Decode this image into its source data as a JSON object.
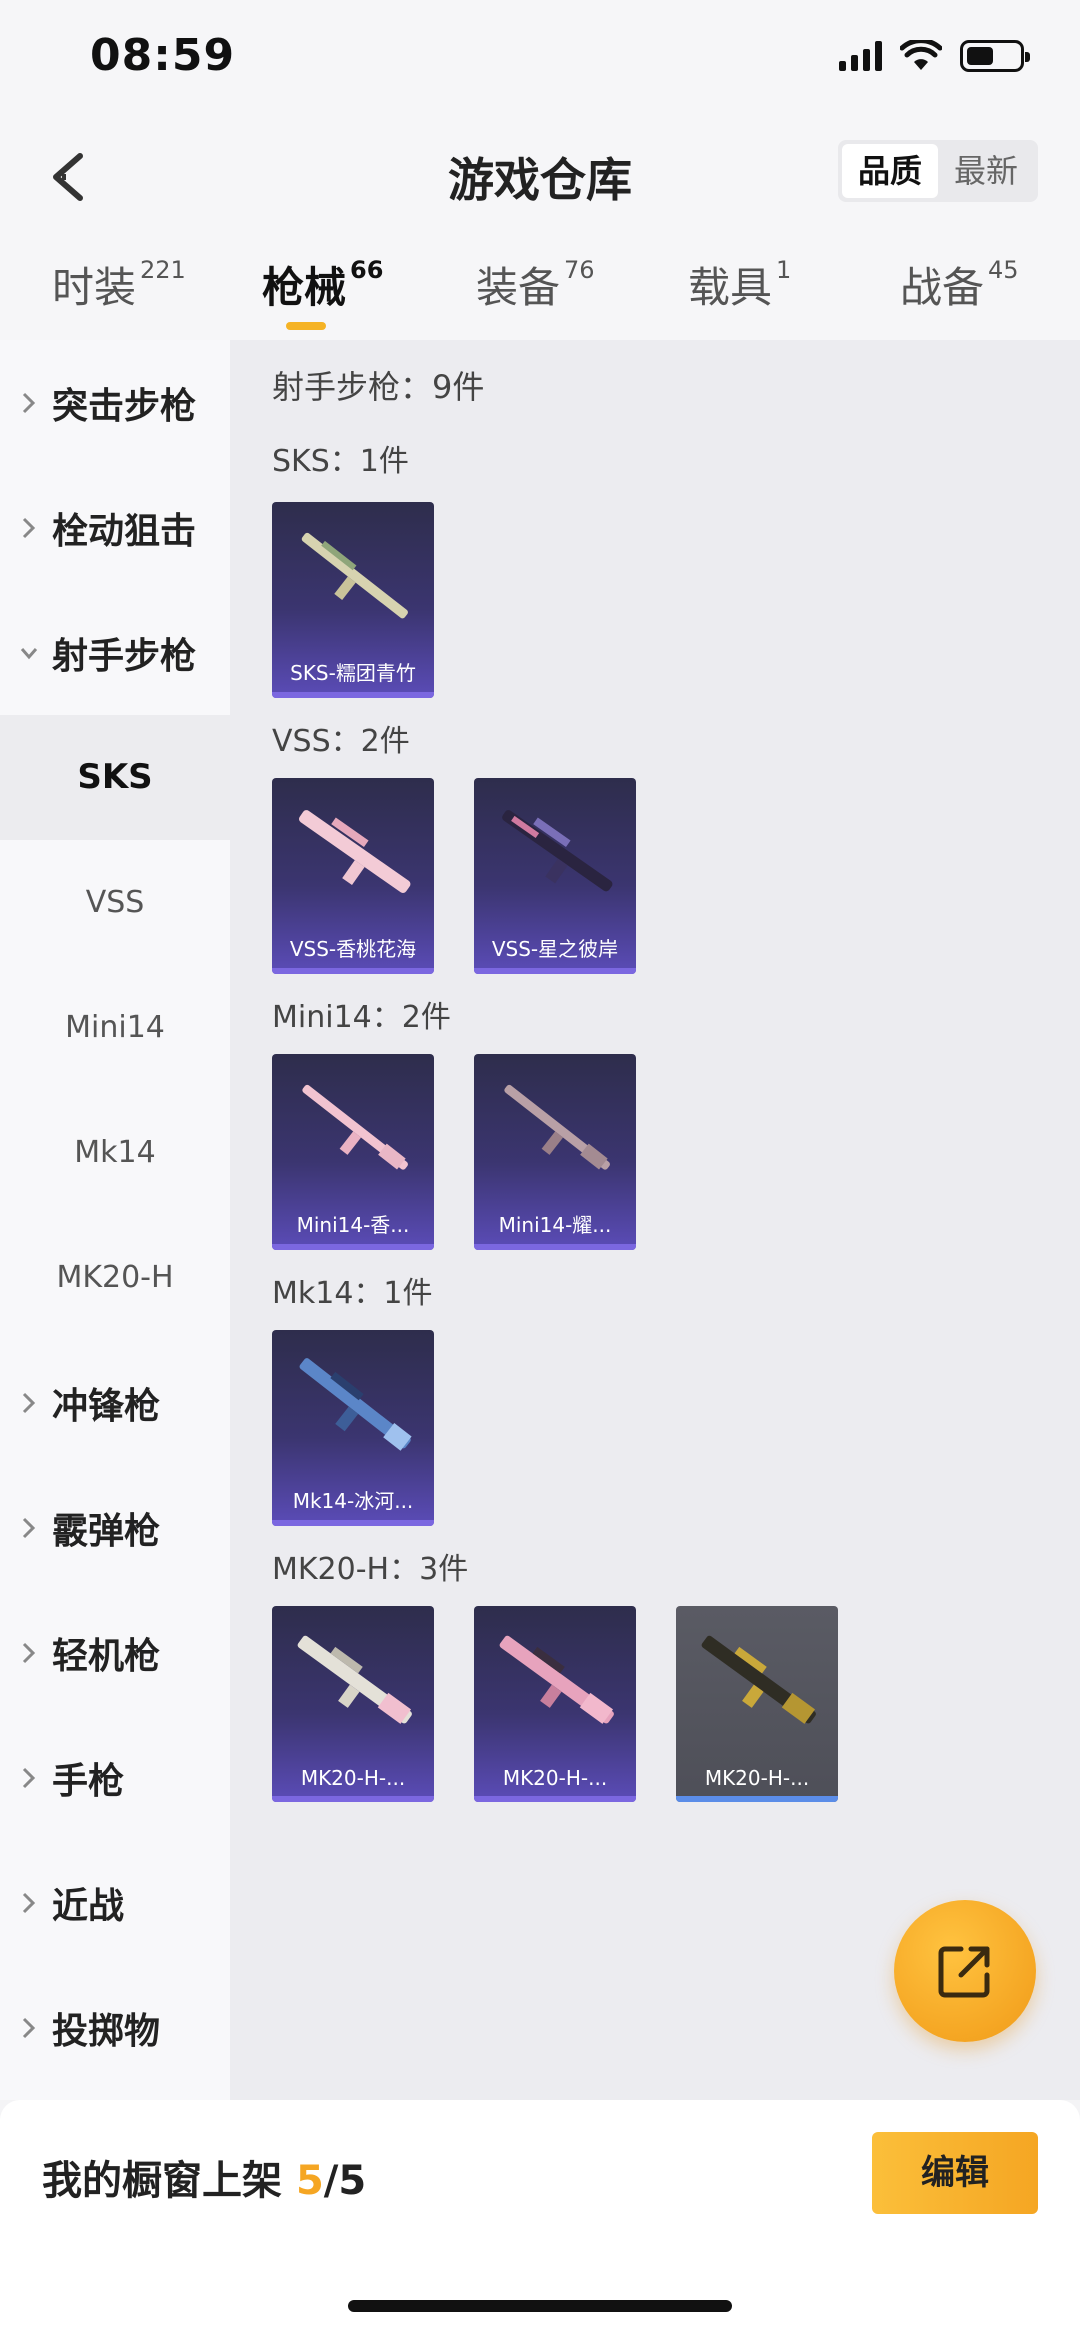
{
  "status": {
    "time": "08:59"
  },
  "header": {
    "title": "游戏仓库",
    "sort_quality": "品质",
    "sort_newest": "最新"
  },
  "tabs": [
    {
      "label": "时装",
      "count": "221"
    },
    {
      "label": "枪械",
      "count": "66"
    },
    {
      "label": "装备",
      "count": "76"
    },
    {
      "label": "载具",
      "count": "1"
    },
    {
      "label": "战备",
      "count": "45"
    }
  ],
  "sidebar": {
    "groups": [
      "突击步枪",
      "栓动狙击",
      "射手步枪",
      "冲锋枪",
      "霰弹枪",
      "轻机枪",
      "手枪",
      "近战",
      "投掷物"
    ],
    "subs": [
      "SKS",
      "VSS",
      "Mini14",
      "Mk14",
      "MK20-H"
    ]
  },
  "content": {
    "category_title": "射手步枪：9件",
    "sections": [
      {
        "head": "SKS：1件",
        "items": [
          "SKS-糯团青竹"
        ]
      },
      {
        "head": "VSS：2件",
        "items": [
          "VSS-香桃花海",
          "VSS-星之彼岸"
        ]
      },
      {
        "head": "Mini14：2件",
        "items": [
          "Mini14-香...",
          "Mini14-耀..."
        ]
      },
      {
        "head": "Mk14：1件",
        "items": [
          "Mk14-冰河..."
        ]
      },
      {
        "head": "MK20-H：3件",
        "items": [
          "MK20-H-...",
          "MK20-H-...",
          "MK20-H-..."
        ]
      }
    ]
  },
  "bottom": {
    "label": "我的橱窗上架",
    "current": "5",
    "total": "/5",
    "edit": "编辑"
  },
  "colors": {
    "accent": "#f5a623",
    "card_purple": "#3b3570",
    "card_grey": "#55565e"
  }
}
